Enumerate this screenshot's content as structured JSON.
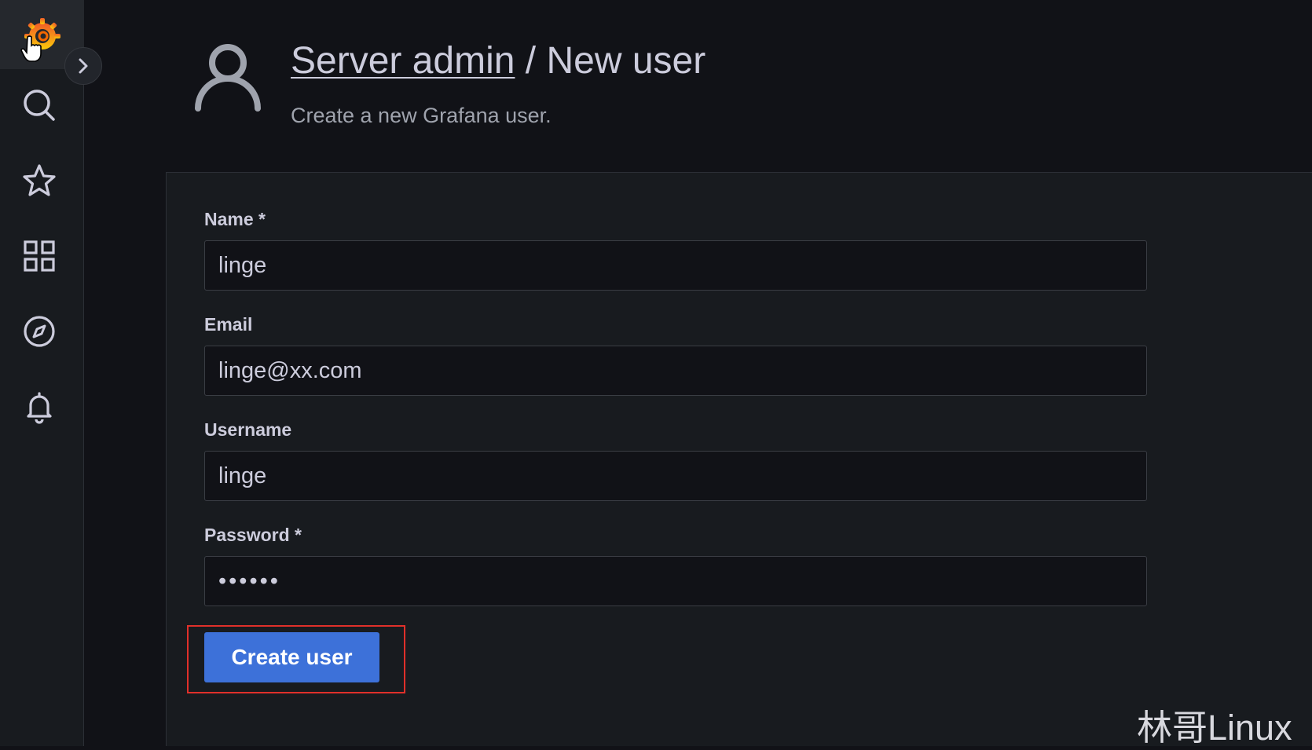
{
  "sidebar": {
    "logo_icon": "grafana-logo-icon",
    "expand_icon": "chevron-right-icon",
    "items": [
      {
        "icon": "search-icon"
      },
      {
        "icon": "star-icon"
      },
      {
        "icon": "dashboards-grid-icon"
      },
      {
        "icon": "explore-compass-icon"
      },
      {
        "icon": "bell-icon"
      }
    ]
  },
  "header": {
    "icon": "user-icon",
    "breadcrumb_link": "Server admin",
    "separator": " / ",
    "title": "New user",
    "subtitle": "Create a new Grafana user."
  },
  "form": {
    "name": {
      "label": "Name *",
      "value": "linge"
    },
    "email": {
      "label": "Email",
      "value": "linge@xx.com"
    },
    "username": {
      "label": "Username",
      "value": "linge"
    },
    "password": {
      "label": "Password *",
      "value": "••••••"
    },
    "submit_label": "Create user"
  },
  "watermark": "林哥Linux",
  "colors": {
    "accent": "#3d71d9",
    "highlight": "#e0302a",
    "logo_orange": "#f46800"
  }
}
